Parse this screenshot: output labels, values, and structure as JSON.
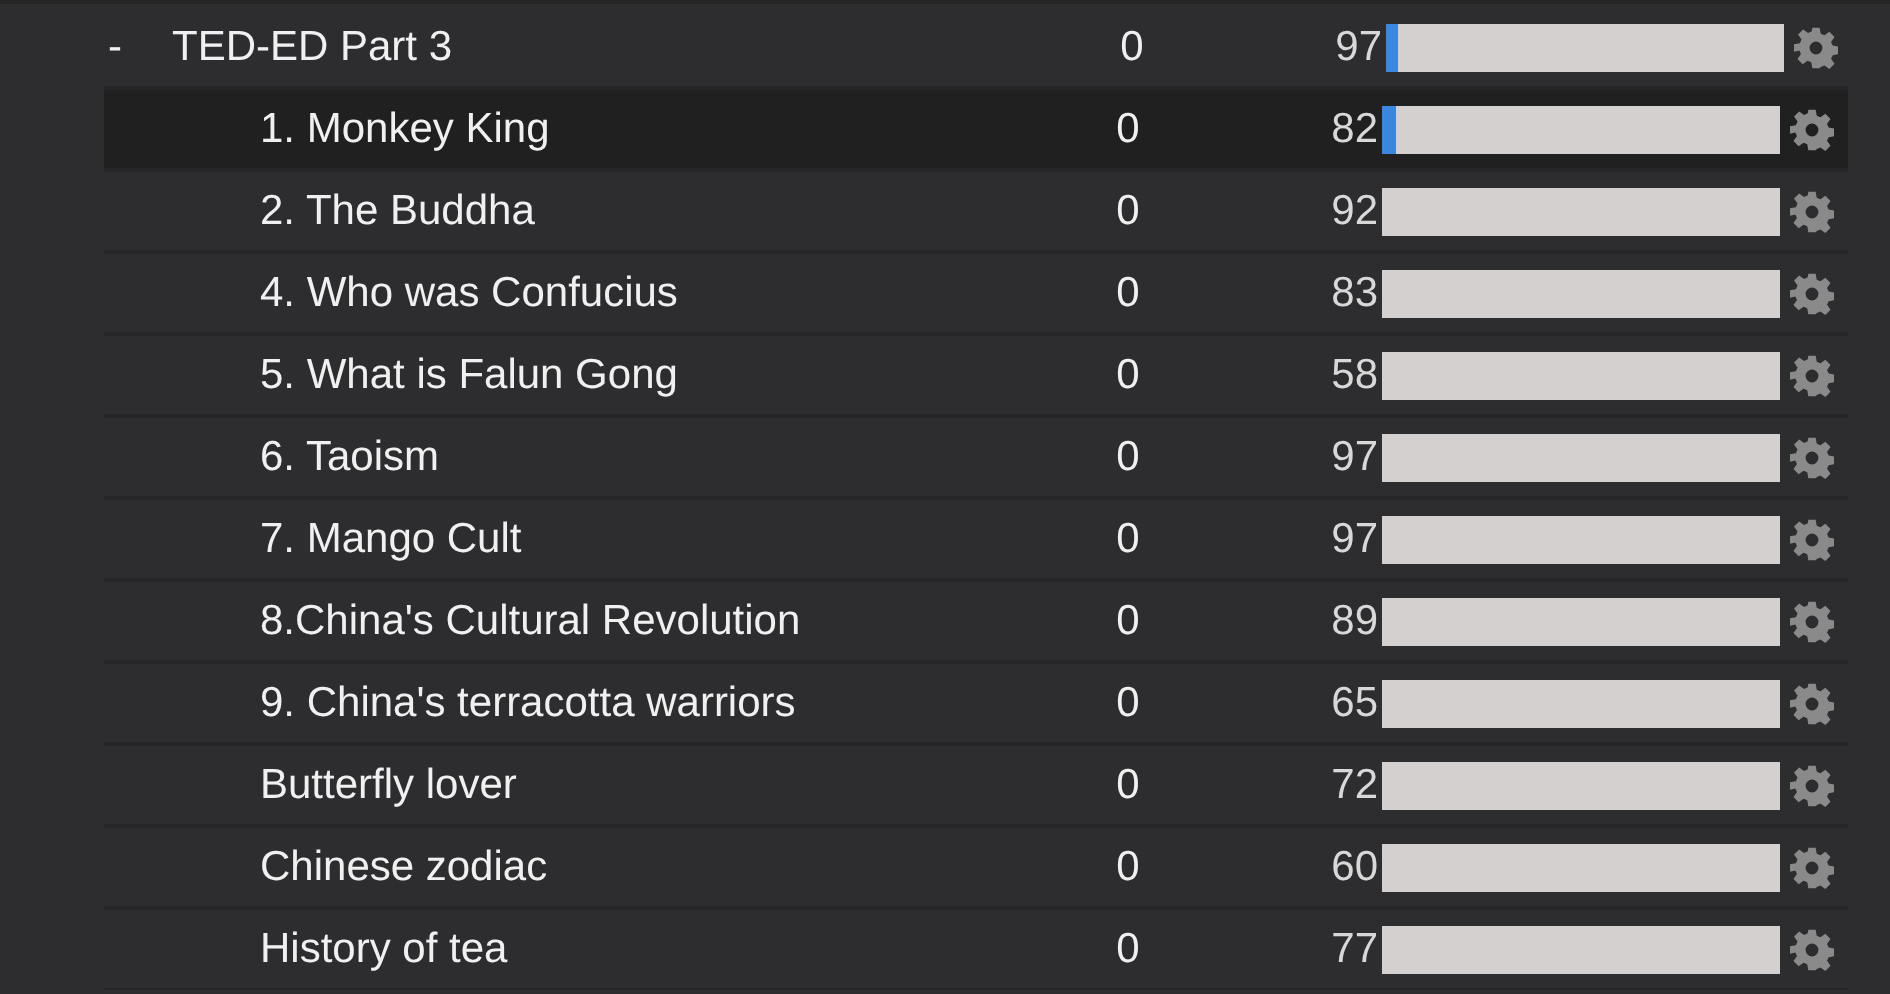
{
  "group": {
    "toggle": "-",
    "title": "TED-ED Part 3",
    "count": "0",
    "score": "97",
    "level": 0.03,
    "selected": false,
    "children": [
      {
        "title": "1. Monkey King",
        "count": "0",
        "score": "82",
        "level": 0.035,
        "selected": true
      },
      {
        "title": "2. The Buddha",
        "count": "0",
        "score": "92",
        "selected": false
      },
      {
        "title": "4. Who was Confucius",
        "count": "0",
        "score": "83",
        "selected": false
      },
      {
        "title": "5. What is Falun Gong",
        "count": "0",
        "score": "58",
        "selected": false
      },
      {
        "title": "6. Taoism",
        "count": "0",
        "score": "97",
        "selected": false
      },
      {
        "title": "7. Mango Cult",
        "count": "0",
        "score": "97",
        "selected": false
      },
      {
        "title": "8.China's Cultural Revolution",
        "count": "0",
        "score": "89",
        "selected": false
      },
      {
        "title": "9. China's terracotta warriors",
        "count": "0",
        "score": "65",
        "selected": false
      },
      {
        "title": "Butterfly lover",
        "count": "0",
        "score": "72",
        "selected": false
      },
      {
        "title": "Chinese zodiac",
        "count": "0",
        "score": "60",
        "selected": false
      },
      {
        "title": "History of tea",
        "count": "0",
        "score": "77",
        "selected": false
      }
    ]
  }
}
